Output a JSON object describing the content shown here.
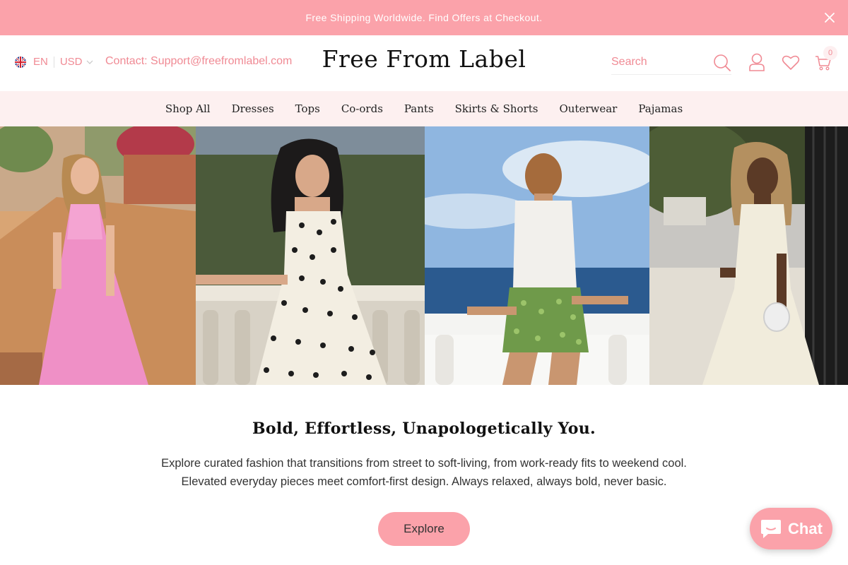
{
  "announcement": {
    "text": "Free Shipping Worldwide. Find Offers at Checkout.",
    "close_icon": "close-icon"
  },
  "header": {
    "language": "EN",
    "currency": "USD",
    "flag_icon": "uk-flag-icon",
    "contact": "Contact: Support@freefromlabel.com",
    "logo": "Free From Label",
    "search_placeholder": "Search",
    "cart_count": "0",
    "icons": [
      "search-icon",
      "user-icon",
      "heart-icon",
      "cart-icon"
    ]
  },
  "nav": {
    "items": [
      "Shop All",
      "Dresses",
      "Tops",
      "Co-ords",
      "Pants",
      "Skirts & Shorts",
      "Outerwear",
      "Pajamas"
    ]
  },
  "hero": {
    "panels": [
      "pink halter maxi dress on terrace",
      "polka dot sundress by hedge",
      "white tank and sequin skirt by sea",
      "cream drop-waist dress in garden"
    ]
  },
  "intro": {
    "headline": "Bold, Effortless, Unapologetically You.",
    "description": "Explore curated fashion that transitions from street to soft-living, from work-ready fits to weekend cool. Elevated everyday pieces meet comfort-first design. Always relaxed, always bold, never basic.",
    "cta": "Explore"
  },
  "chat": {
    "label": "Chat",
    "icon": "chat-bubble-icon"
  },
  "colors": {
    "accent": "#fba2aa",
    "accent_text": "#f08a94",
    "nav_bg": "#fdf0f0"
  }
}
